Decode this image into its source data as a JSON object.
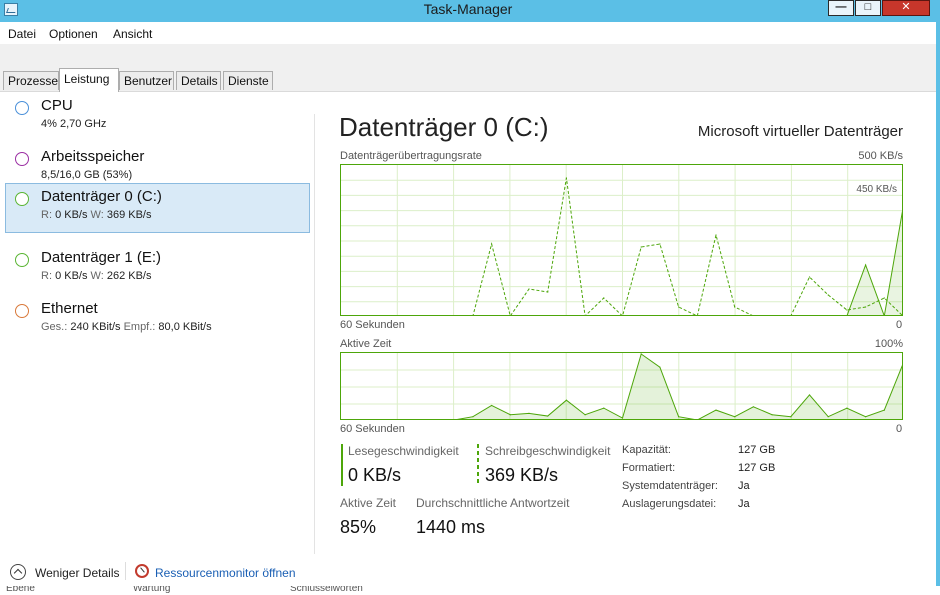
{
  "window": {
    "title": "Task-Manager",
    "controls": {
      "minimize": "—",
      "maximize": "□",
      "close": "✕"
    }
  },
  "menu": [
    "Datei",
    "Optionen",
    "Ansicht"
  ],
  "tabs": [
    "Prozesse",
    "Leistung",
    "Benutzer",
    "Details",
    "Dienste"
  ],
  "active_tab": "Leistung",
  "sidebar": [
    {
      "title": "CPU",
      "k1": "",
      "v1": "4% 2,70 GHz",
      "k2": "",
      "v2": "",
      "color": "#4a90d9"
    },
    {
      "title": "Arbeitsspeicher",
      "k1": "",
      "v1": "8,5/16,0 GB (53%)",
      "k2": "",
      "v2": "",
      "color": "#9b2fa3"
    },
    {
      "title": "Datenträger 0 (C:)",
      "k1": "R:",
      "v1": "0 KB/s",
      "k2": "W:",
      "v2": "369 KB/s",
      "color": "#5ab533",
      "selected": true
    },
    {
      "title": "Datenträger 1 (E:)",
      "k1": "R:",
      "v1": "0 KB/s",
      "k2": "W:",
      "v2": "262 KB/s",
      "color": "#5ab533"
    },
    {
      "title": "Ethernet",
      "k1": "Ges.:",
      "v1": "240 KBit/s",
      "k2": "Empf.:",
      "v2": "80,0 KBit/s",
      "color": "#d9793a"
    }
  ],
  "main": {
    "title": "Datenträger 0 (C:)",
    "model": "Microsoft virtueller Datenträger",
    "graph1": {
      "label": "Datenträgerübertragungsrate",
      "max": "500 KB/s",
      "inner_max": "450 KB/s",
      "time_label": "60 Sekunden",
      "zero": "0"
    },
    "graph2": {
      "label": "Aktive Zeit",
      "max": "100%",
      "time_label": "60 Sekunden",
      "zero": "0"
    },
    "stats": {
      "read_label": "Lesegeschwindigkeit",
      "read_value": "0 KB/s",
      "write_label": "Schreibgeschwindigkeit",
      "write_value": "369 KB/s",
      "active_label": "Aktive Zeit",
      "active_value": "85%",
      "resp_label": "Durchschnittliche Antwortzeit",
      "resp_value": "1440 ms"
    },
    "props": [
      {
        "k": "Kapazität:",
        "v": "127 GB"
      },
      {
        "k": "Formatiert:",
        "v": "127 GB"
      },
      {
        "k": "Systemdatenträger:",
        "v": "Ja"
      },
      {
        "k": "Auslagerungsdatei:",
        "v": "Ja"
      }
    ]
  },
  "footer": {
    "less_details": "Weniger Details",
    "resmon": "Ressourcenmonitor öffnen"
  },
  "background_band": [
    "Ebene",
    "Wartung",
    "Schlüsselworten"
  ],
  "colors": {
    "accent": "#4da60a",
    "selected_bg": "#d9eaf7",
    "link": "#1a5fb4",
    "titlebar": "#5bbfe6"
  },
  "chart_data": [
    {
      "type": "area",
      "title": "Datenträgerübertragungsrate",
      "ylabel": "KB/s",
      "xlabel": "60 Sekunden",
      "ylim": [
        0,
        500
      ],
      "x": [
        60,
        58,
        56,
        54,
        52,
        50,
        48,
        46,
        44,
        42,
        40,
        38,
        36,
        34,
        32,
        30,
        28,
        26,
        24,
        22,
        20,
        18,
        16,
        14,
        12,
        10,
        8,
        6,
        4,
        2,
        0
      ],
      "series": [
        {
          "values": [
            0,
            0,
            0,
            0,
            0,
            0,
            0,
            0,
            0,
            0,
            0,
            0,
            0,
            0,
            0,
            0,
            0,
            0,
            0,
            0,
            0,
            0,
            0,
            0,
            0,
            0,
            0,
            0,
            170,
            0,
            360
          ]
        },
        {
          "values": [
            0,
            0,
            0,
            0,
            0,
            0,
            0,
            0,
            240,
            0,
            90,
            80,
            460,
            0,
            60,
            0,
            230,
            240,
            30,
            0,
            270,
            30,
            0,
            0,
            0,
            130,
            70,
            20,
            30,
            60,
            0
          ]
        }
      ],
      "grid": true
    },
    {
      "type": "area",
      "title": "Aktive Zeit",
      "ylabel": "%",
      "xlabel": "60 Sekunden",
      "ylim": [
        0,
        100
      ],
      "x": [
        60,
        58,
        56,
        54,
        52,
        50,
        48,
        46,
        44,
        42,
        40,
        38,
        36,
        34,
        32,
        30,
        28,
        26,
        24,
        22,
        20,
        18,
        16,
        14,
        12,
        10,
        8,
        6,
        4,
        2,
        0
      ],
      "series": [
        {
          "values": [
            0,
            0,
            0,
            0,
            0,
            0,
            0,
            5,
            22,
            8,
            10,
            6,
            30,
            8,
            18,
            3,
            100,
            80,
            5,
            0,
            15,
            5,
            20,
            8,
            5,
            38,
            5,
            18,
            5,
            15,
            85
          ]
        }
      ],
      "grid": true
    }
  ]
}
